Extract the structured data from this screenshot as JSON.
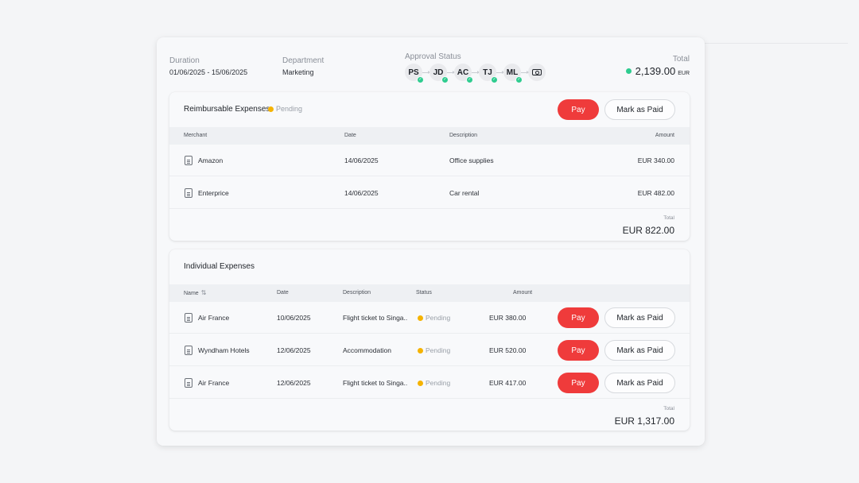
{
  "header": {
    "duration_label": "Duration",
    "duration_value": "01/06/2025 - 15/06/2025",
    "department_label": "Department",
    "department_value": "Marketing",
    "approval_label": "Approval Status",
    "approvers": [
      "PS",
      "JD",
      "AC",
      "TJ",
      "ML"
    ],
    "total_label": "Total",
    "total_value": "2,139.00",
    "total_currency": "EUR",
    "total_status_color": "#2ecc8f"
  },
  "reimbursable": {
    "title": "Reimbursable Expenses",
    "status": "Pending",
    "pay_label": "Pay",
    "mark_label": "Mark as Paid",
    "columns": [
      "Merchant",
      "Date",
      "Description",
      "Amount"
    ],
    "rows": [
      {
        "merchant": "Amazon",
        "date": "14/06/2025",
        "description": "Office supplies",
        "amount": "EUR  340.00"
      },
      {
        "merchant": "Enterprice",
        "date": "14/06/2025",
        "description": "Car rental",
        "amount": "EUR  482.00"
      }
    ],
    "total_label": "Total",
    "total_value": "EUR  822.00"
  },
  "individual": {
    "title": "Individual Expenses",
    "columns": [
      "Name",
      "Date",
      "Description",
      "Status",
      "Amount"
    ],
    "sort_icon": "⇅",
    "pay_label": "Pay",
    "mark_label": "Mark as Paid",
    "rows": [
      {
        "name": "Air France",
        "date": "10/06/2025",
        "description": "Flight ticket to Singa..",
        "status": "Pending",
        "amount": "EUR 380.00"
      },
      {
        "name": "Wyndham Hotels",
        "date": "12/06/2025",
        "description": "Accommodation",
        "status": "Pending",
        "amount": "EUR  520.00"
      },
      {
        "name": "Air France",
        "date": "12/06/2025",
        "description": "Flight ticket to Singa..",
        "status": "Pending",
        "amount": "EUR  417.00"
      }
    ],
    "total_label": "Total",
    "total_value": "EUR  1,317.00"
  },
  "colors": {
    "pay": "#ef3b3b",
    "pending": "#f5b301",
    "approved": "#2ecc8f"
  }
}
